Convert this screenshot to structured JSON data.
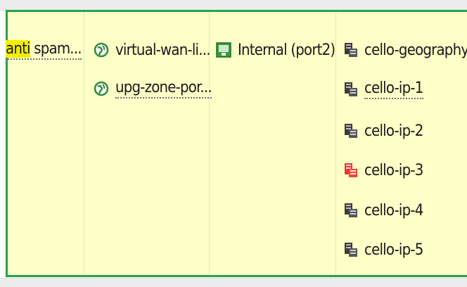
{
  "policy_row": {
    "name_cell": {
      "highlight": "anti",
      "rest": " spam..."
    },
    "source_cell": [
      {
        "label": "virtual-wan-li...",
        "icon": "zone-globe-icon"
      },
      {
        "label": "upg-zone-por...",
        "icon": "zone-globe-icon"
      }
    ],
    "interface_cell": [
      {
        "label": "Internal (port2)",
        "icon": "interface-port-icon"
      }
    ],
    "dest_cell": [
      {
        "label": "cello-geography",
        "icon": "server-address-icon",
        "status": "normal"
      },
      {
        "label": "cello-ip-1",
        "icon": "server-address-icon",
        "status": "normal"
      },
      {
        "label": "cello-ip-2",
        "icon": "server-address-icon",
        "status": "normal"
      },
      {
        "label": "cello-ip-3",
        "icon": "server-address-error-icon",
        "status": "error"
      },
      {
        "label": "cello-ip-4",
        "icon": "server-address-icon",
        "status": "normal"
      },
      {
        "label": "cello-ip-5",
        "icon": "server-address-icon",
        "status": "normal"
      }
    ]
  },
  "colors": {
    "row_bg": "#ffffc8",
    "row_border": "#27a34a",
    "highlight": "#f2ee00",
    "error_icon": "#e53935",
    "zone_icon": "#2e8b3a"
  }
}
